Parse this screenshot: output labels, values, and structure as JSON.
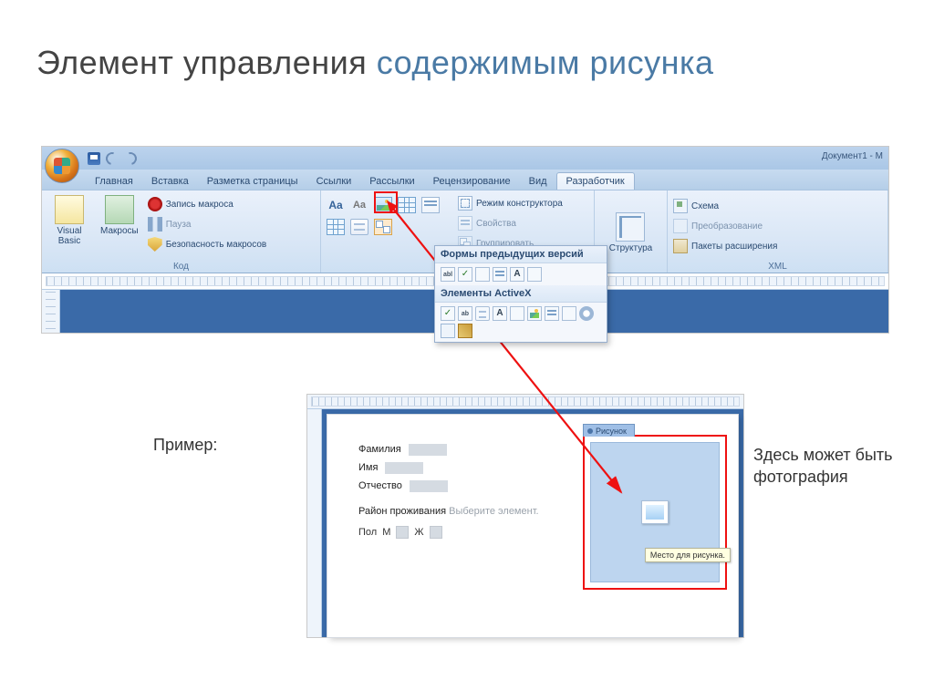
{
  "title": {
    "part1": "Элемент управления ",
    "part2": "содержимым рисунка"
  },
  "word": {
    "doc_title": "Документ1 - M",
    "tabs": [
      "Главная",
      "Вставка",
      "Разметка страницы",
      "Ссылки",
      "Рассылки",
      "Рецензирование",
      "Вид",
      "Разработчик"
    ],
    "groups": {
      "code": {
        "label": "Код",
        "visual_basic": "Visual\nBasic",
        "macros": "Макросы",
        "record": "Запись макроса",
        "pause": "Пауза",
        "security": "Безопасность макросов"
      },
      "controls": {
        "design_mode": "Режим конструктора",
        "properties": "Свойства",
        "group": "Группировать"
      },
      "structure": {
        "label": "Структура"
      },
      "xml": {
        "label": "XML",
        "schema": "Схема",
        "transform": "Преобразование",
        "packs": "Пакеты расширения"
      }
    },
    "dropdown": {
      "legacy": "Формы предыдущих версий",
      "activex": "Элементы ActiveX"
    }
  },
  "example": {
    "label": "Пример:",
    "caption": "Здесь может быть фотография",
    "fields": {
      "surname": "Фамилия",
      "name": "Имя",
      "patronymic": "Отчество"
    },
    "region_label": "Район проживания",
    "region_hint": "Выберите элемент.",
    "sex_label": "Пол",
    "sex_m": "М",
    "sex_f": "Ж",
    "pic_tab": "Рисунок",
    "pic_tip": "Место для рисунка."
  }
}
